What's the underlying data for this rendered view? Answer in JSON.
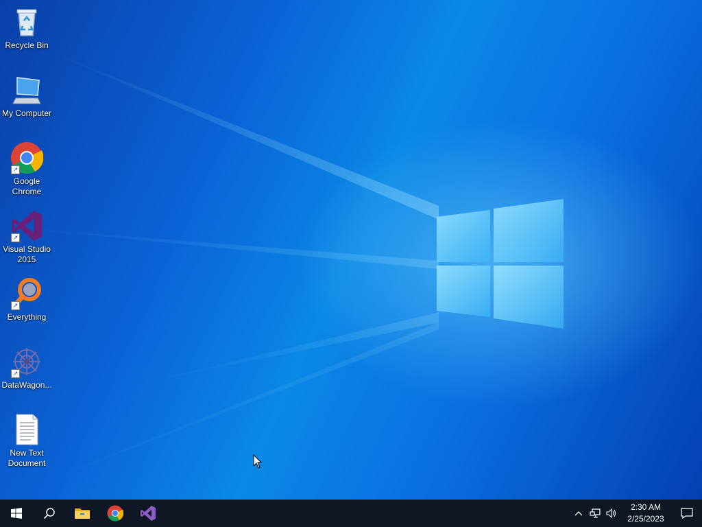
{
  "desktop": {
    "icons": [
      {
        "label": "Recycle Bin",
        "icon": "recycle-bin-icon"
      },
      {
        "label": "My Computer",
        "icon": "computer-icon"
      },
      {
        "label": "Google Chrome",
        "icon": "chrome-icon"
      },
      {
        "label": "Visual Studio 2015",
        "icon": "visual-studio-icon"
      },
      {
        "label": "Everything",
        "icon": "everything-search-icon"
      },
      {
        "label": "DataWagon...",
        "icon": "datawagon-icon"
      },
      {
        "label": "New Text Document",
        "icon": "text-document-icon"
      }
    ],
    "wallpaper": "windows-logo-wallpaper"
  },
  "taskbar": {
    "pinned": [
      {
        "name": "start",
        "icon": "windows-start-icon"
      },
      {
        "name": "search",
        "icon": "search-icon"
      },
      {
        "name": "file-explorer",
        "icon": "folder-icon"
      },
      {
        "name": "chrome",
        "icon": "chrome-icon"
      },
      {
        "name": "visual-studio",
        "icon": "visual-studio-icon"
      }
    ],
    "tray": {
      "time": "2:30 AM",
      "date": "2/25/2023"
    }
  },
  "colors": {
    "taskbar_bg": "#0f1724",
    "accent": "#0a78e0"
  }
}
